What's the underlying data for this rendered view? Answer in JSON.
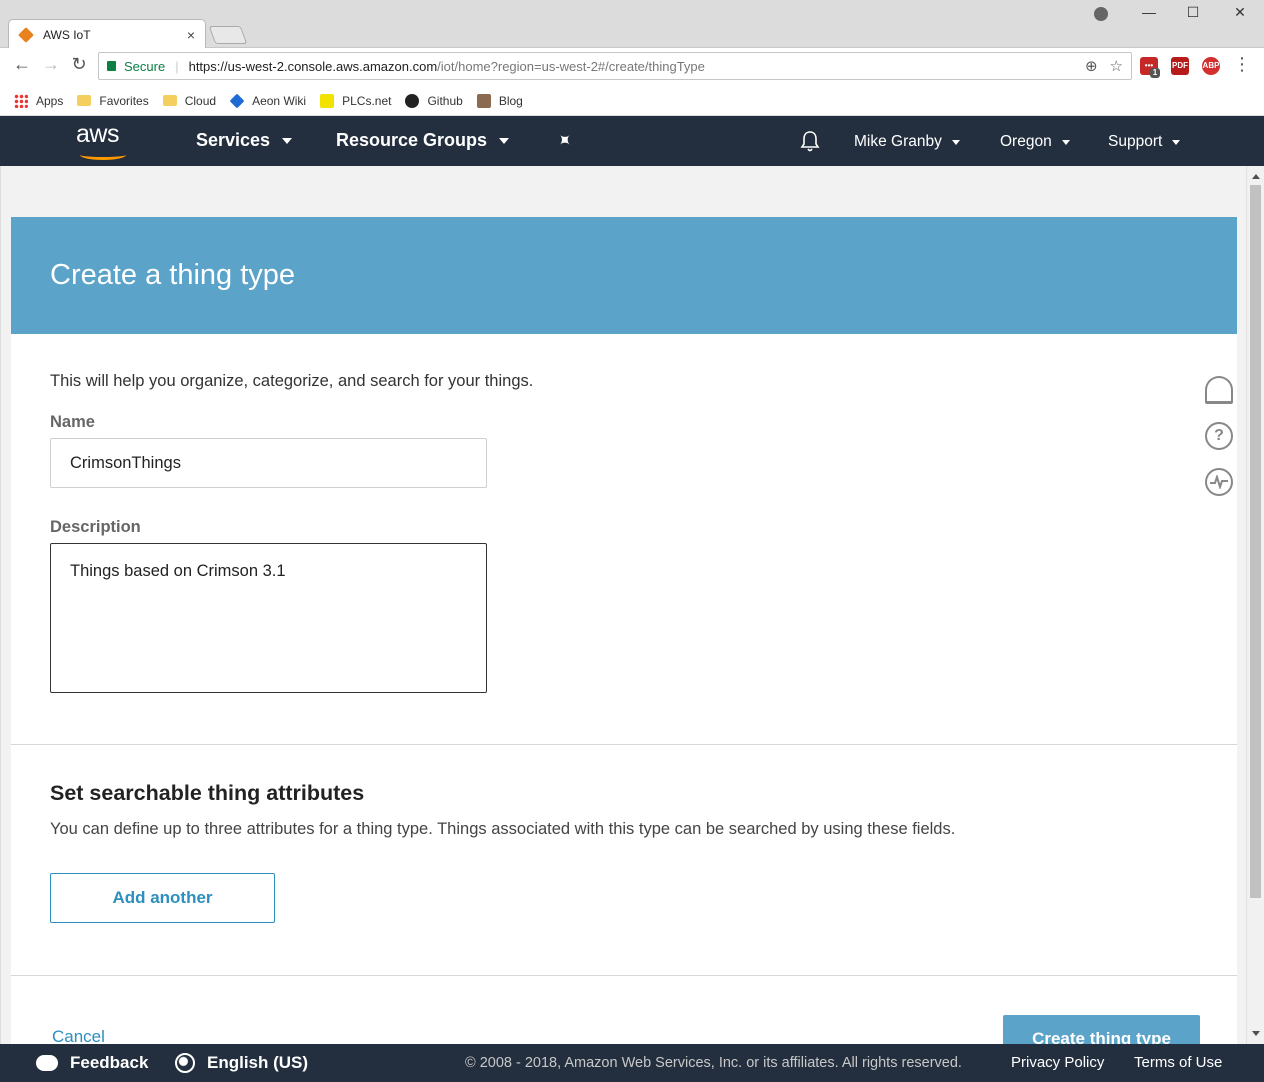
{
  "browser": {
    "tab_title": "AWS IoT",
    "tab_close": "×",
    "window_controls": {
      "minimize": "—",
      "maximize": "☐",
      "close": "✕"
    },
    "nav": {
      "back": "←",
      "forward": "→",
      "reload": "↻"
    },
    "secure_label": "Secure",
    "url_main": "https://us-west-2.console.aws.amazon.com",
    "url_rest": "/iot/home?region=us-west-2#/create/thingType",
    "zoom_icon": "⊕",
    "star_icon": "☆",
    "menu_icon": "⋮",
    "extensions": [
      {
        "label": "•••",
        "badge": "1",
        "color": "#c62828"
      },
      {
        "label": "PDF",
        "color": "#b71c1c"
      },
      {
        "label": "ABP",
        "color": "#d32f2f"
      }
    ],
    "bookmarks": [
      {
        "label": "Apps",
        "icon": "apps-icon"
      },
      {
        "label": "Favorites",
        "icon": "folder-icon"
      },
      {
        "label": "Cloud",
        "icon": "folder-icon"
      },
      {
        "label": "Aeon Wiki",
        "icon": "aeon-icon"
      },
      {
        "label": "PLCs.net",
        "icon": "plcs-icon"
      },
      {
        "label": "Github",
        "icon": "github-icon"
      },
      {
        "label": "Blog",
        "icon": "blog-icon"
      }
    ]
  },
  "aws_nav": {
    "logo": "aws",
    "services": "Services",
    "resource_groups": "Resource Groups",
    "pin": "📌",
    "bell": "🔔",
    "user": "Mike Granby",
    "region": "Oregon",
    "support": "Support"
  },
  "page": {
    "title": "Create a thing type",
    "intro": "This will help you organize, categorize, and search for your things.",
    "name_label": "Name",
    "name_value": "CrimsonThings",
    "description_label": "Description",
    "description_value": "Things based on Crimson 3.1",
    "attributes_title": "Set searchable thing attributes",
    "attributes_desc": "You can define up to three attributes for a thing type. Things associated with this type can be searched by using these fields.",
    "add_another": "Add another",
    "cancel": "Cancel",
    "create": "Create thing type",
    "side_help": "?"
  },
  "footer": {
    "feedback": "Feedback",
    "language": "English (US)",
    "copyright": "© 2008 - 2018, Amazon Web Services, Inc. or its affiliates. All rights reserved.",
    "privacy": "Privacy Policy",
    "terms": "Terms of Use"
  },
  "colors": {
    "header_blue": "#5ba3c9",
    "nav_dark": "#232f3e",
    "link_blue": "#2d8fbf",
    "aws_orange": "#ff9900"
  }
}
